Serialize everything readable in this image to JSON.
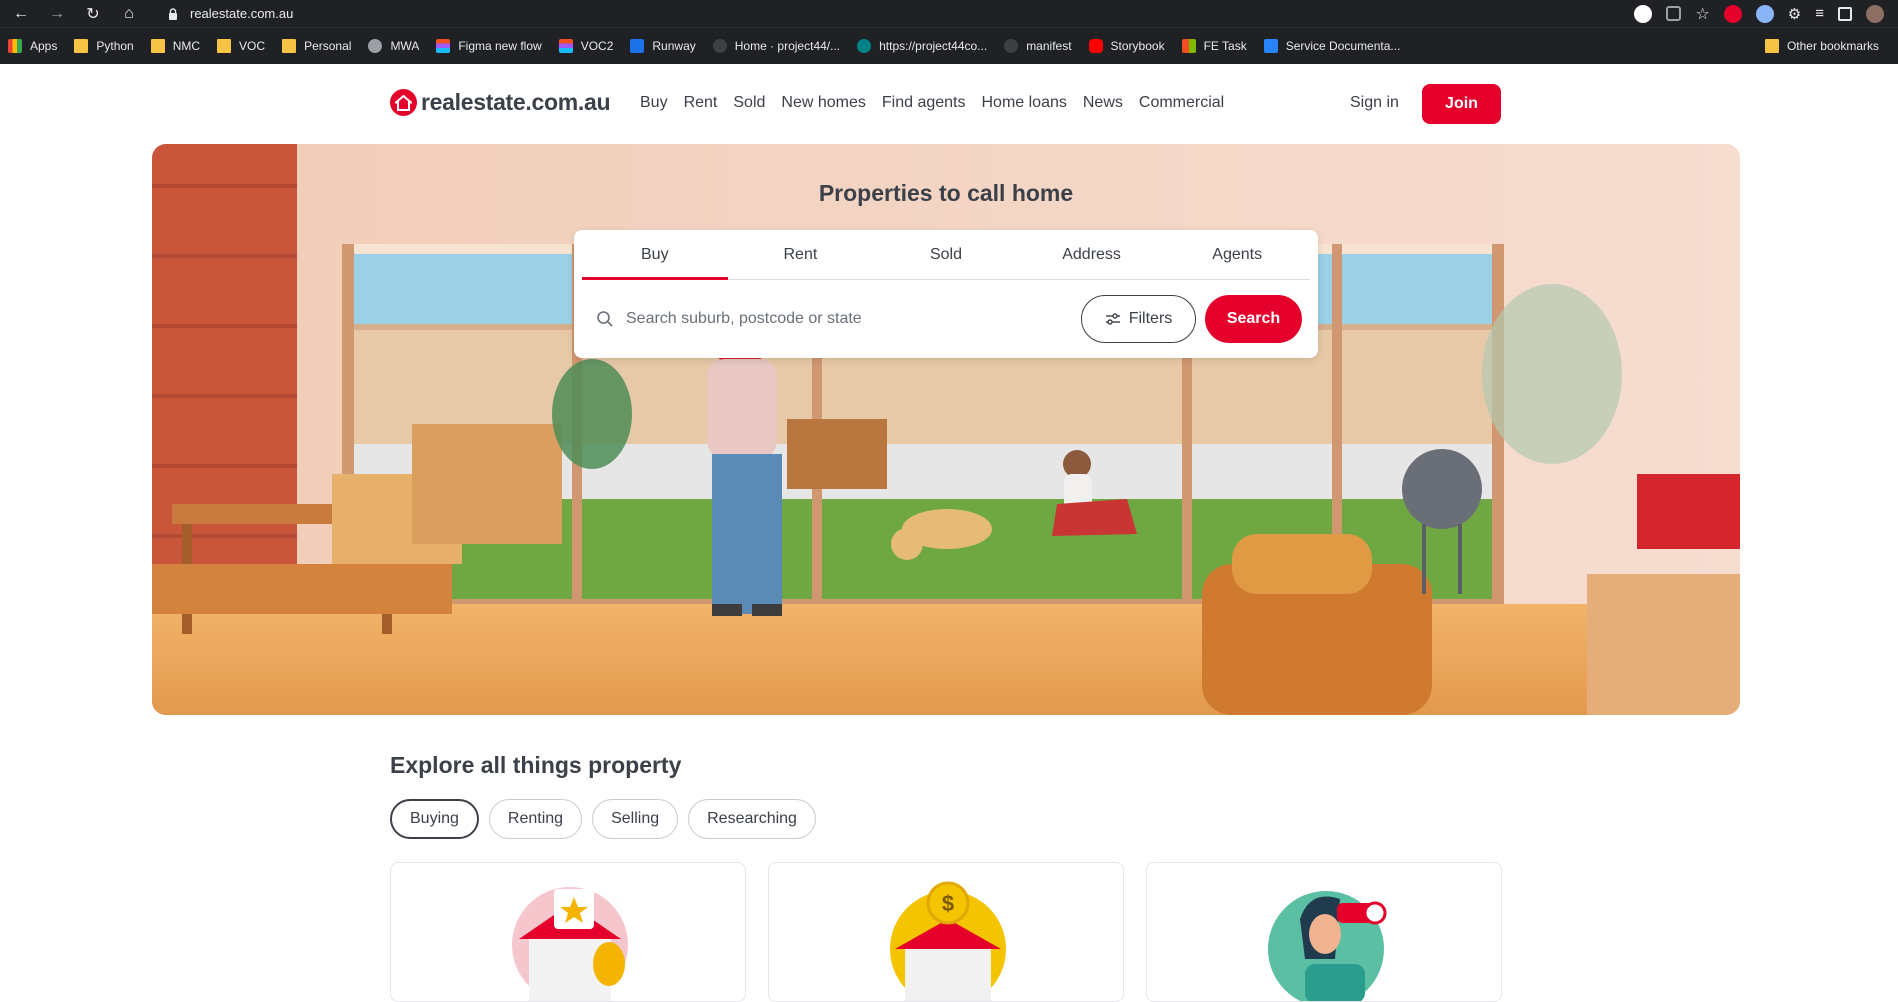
{
  "browser": {
    "url": "realestate.com.au",
    "bookmarks": [
      "Apps",
      "Python",
      "NMC",
      "VOC",
      "Personal",
      "MWA",
      "Figma new flow",
      "VOC2",
      "Runway",
      "Home · project44/...",
      "https://project44co...",
      "manifest",
      "Storybook",
      "FE Task",
      "Service Documenta..."
    ],
    "other_bookmarks": "Other bookmarks"
  },
  "header": {
    "logo_text": "realestate.com.au",
    "nav": [
      "Buy",
      "Rent",
      "Sold",
      "New homes",
      "Find agents",
      "Home loans",
      "News",
      "Commercial"
    ],
    "sign_in": "Sign in",
    "join": "Join"
  },
  "hero": {
    "title": "Properties to call home",
    "tabs": [
      "Buy",
      "Rent",
      "Sold",
      "Address",
      "Agents"
    ],
    "active_tab": "Buy",
    "search_placeholder": "Search suburb, postcode or state",
    "filters_label": "Filters",
    "search_label": "Search"
  },
  "explore": {
    "title": "Explore all things property",
    "pills": [
      "Buying",
      "Renting",
      "Selling",
      "Researching"
    ],
    "active_pill": "Buying"
  },
  "colors": {
    "brand": "#e4002b",
    "text": "#3b4049"
  }
}
